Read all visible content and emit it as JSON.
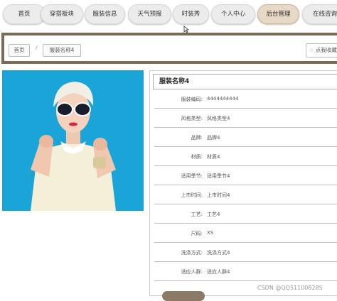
{
  "nav": {
    "items": [
      {
        "label": "首页"
      },
      {
        "label": "穿搭板块"
      },
      {
        "label": "服装信息"
      },
      {
        "label": "天气预报"
      },
      {
        "label": "时装秀"
      },
      {
        "label": "个人中心"
      },
      {
        "label": "后台管理",
        "active": true
      },
      {
        "label": "在线咨询"
      }
    ]
  },
  "breadcrumb": {
    "home": "首页",
    "separator": "/",
    "current": "服装名称4"
  },
  "favorite": {
    "label": "点我收藏"
  },
  "detail": {
    "title": "服装名称4",
    "fields": [
      {
        "label": "服装编码:",
        "value": "4444444444"
      },
      {
        "label": "风格类型:",
        "value": "风格类型4"
      },
      {
        "label": "品牌:",
        "value": "品牌4"
      },
      {
        "label": "材质:",
        "value": "材质4"
      },
      {
        "label": "适用季节:",
        "value": "适用季节4"
      },
      {
        "label": "上市时间:",
        "value": "上市时间4"
      },
      {
        "label": "工艺:",
        "value": "工艺4"
      },
      {
        "label": "尺码:",
        "value": "XS"
      },
      {
        "label": "洗涤方式:",
        "value": "洗涤方式4"
      },
      {
        "label": "适应人群:",
        "value": "适应人群4"
      }
    ]
  },
  "watermark": "CSDN @QQ511008285",
  "colors": {
    "accent": "#7a6a57",
    "active_nav": "#e8d9c6",
    "photo_bg": "#1aa4d8"
  }
}
